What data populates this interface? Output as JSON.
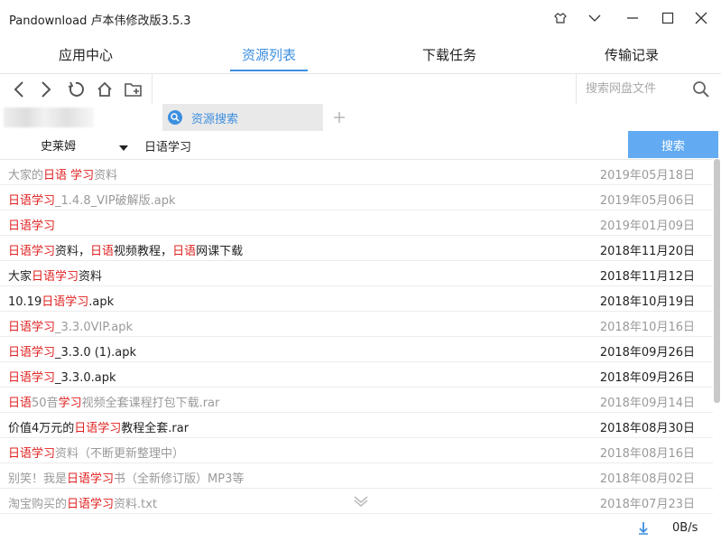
{
  "window": {
    "title": "Pandownload 卢本伟修改版3.5.3"
  },
  "main_tabs": [
    "应用中心",
    "资源列表",
    "下载任务",
    "传输记录"
  ],
  "toolbar": {
    "search_placeholder": "搜索网盘文件"
  },
  "tabs": {
    "search_tab_label": "资源搜索"
  },
  "searchbar": {
    "user": "史莱姆",
    "keyword": "日语学习",
    "button": "搜索"
  },
  "results": [
    {
      "parts": [
        {
          "t": "大家的",
          "h": false
        },
        {
          "t": "日语 学习",
          "h": true
        },
        {
          "t": "资料",
          "h": false
        }
      ],
      "date": "2019年05月18日",
      "gray": true
    },
    {
      "parts": [
        {
          "t": "日语学习",
          "h": true
        },
        {
          "t": "_1.4.8_VIP破解版.apk",
          "h": false
        }
      ],
      "date": "2019年05月06日",
      "gray": true
    },
    {
      "parts": [
        {
          "t": "日语学习",
          "h": true
        }
      ],
      "date": "2019年01月09日",
      "gray": true
    },
    {
      "parts": [
        {
          "t": "日语学习",
          "h": true
        },
        {
          "t": "资料，",
          "h": false
        },
        {
          "t": "日语",
          "h": true
        },
        {
          "t": "视频教程，",
          "h": false
        },
        {
          "t": "日语",
          "h": true
        },
        {
          "t": "网课下载",
          "h": false
        }
      ],
      "date": "2018年11月20日",
      "gray": false
    },
    {
      "parts": [
        {
          "t": "大家",
          "h": false
        },
        {
          "t": "日语学习",
          "h": true
        },
        {
          "t": "资料",
          "h": false
        }
      ],
      "date": "2018年11月12日",
      "gray": false
    },
    {
      "parts": [
        {
          "t": "10.19",
          "h": false
        },
        {
          "t": "日语学习",
          "h": true
        },
        {
          "t": ".apk",
          "h": false
        }
      ],
      "date": "2018年10月19日",
      "gray": false
    },
    {
      "parts": [
        {
          "t": "日语学习",
          "h": true
        },
        {
          "t": "_3.3.0VIP.apk",
          "h": false
        }
      ],
      "date": "2018年10月16日",
      "gray": true
    },
    {
      "parts": [
        {
          "t": "日语学习",
          "h": true
        },
        {
          "t": "_3.3.0 (1).apk",
          "h": false
        }
      ],
      "date": "2018年09月26日",
      "gray": false
    },
    {
      "parts": [
        {
          "t": "日语学习",
          "h": true
        },
        {
          "t": "_3.3.0.apk",
          "h": false
        }
      ],
      "date": "2018年09月26日",
      "gray": false
    },
    {
      "parts": [
        {
          "t": "日语",
          "h": true
        },
        {
          "t": "50音",
          "h": false
        },
        {
          "t": "学习",
          "h": true
        },
        {
          "t": "视频全套课程打包下载.rar",
          "h": false
        }
      ],
      "date": "2018年09月14日",
      "gray": true
    },
    {
      "parts": [
        {
          "t": "价值4万元的",
          "h": false
        },
        {
          "t": "日语学习",
          "h": true
        },
        {
          "t": "教程全套.rar",
          "h": false
        }
      ],
      "date": "2018年08月30日",
      "gray": false
    },
    {
      "parts": [
        {
          "t": "日语学习",
          "h": true
        },
        {
          "t": "资料（不断更新整理中）",
          "h": false
        }
      ],
      "date": "2018年08月16日",
      "gray": true
    },
    {
      "parts": [
        {
          "t": "别笑！我是",
          "h": false
        },
        {
          "t": "日语学习",
          "h": true
        },
        {
          "t": "书（全新修订版）MP3等",
          "h": false
        }
      ],
      "date": "2018年08月02日",
      "gray": true
    },
    {
      "parts": [
        {
          "t": "淘宝购买的",
          "h": false
        },
        {
          "t": "日语学习",
          "h": true
        },
        {
          "t": "资料.txt",
          "h": false
        }
      ],
      "date": "2018年07月23日",
      "gray": true
    }
  ],
  "status": {
    "speed": "0B/s"
  },
  "colors": {
    "accent": "#3d8fe0",
    "highlight": "#e02020",
    "button": "#62aaf1"
  }
}
